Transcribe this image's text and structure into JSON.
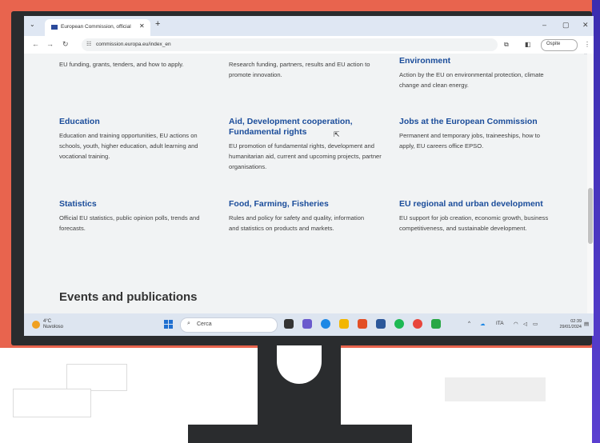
{
  "browser": {
    "tab_title": "European Commission, official",
    "tab_close": "✕",
    "tab_new": "+",
    "url": "commission.europa.eu/index_en",
    "guest_label": "Ospite",
    "window_controls": [
      "–",
      "▢",
      "✕"
    ]
  },
  "content": {
    "partial_top": [
      "EU funding, grants, tenders, and how to apply.",
      "Research funding, partners, results and EU action to promote innovation."
    ],
    "sections": [
      {
        "title": "Environment",
        "desc": "Action by the EU on environmental protection, climate change and clean energy."
      },
      {
        "title": "Education",
        "desc": "Education and training opportunities, EU actions on schools, youth, higher education, adult learning and vocational training."
      },
      {
        "title": "Aid, Development cooperation, Fundamental rights",
        "desc": "EU promotion of fundamental rights, development and humanitarian aid, current and upcoming projects, partner organisations."
      },
      {
        "title": "Jobs at the European Commission",
        "desc": "Permanent and temporary jobs, traineeships, how to apply, EU careers office EPSO."
      },
      {
        "title": "Statistics",
        "desc": "Official EU statistics, public opinion polls, trends and forecasts."
      },
      {
        "title": "Food, Farming, Fisheries",
        "desc": "Rules and policy for safety and quality, information and statistics on products and markets."
      },
      {
        "title": "EU regional and urban development",
        "desc": "EU support for job creation, economic growth, business competitiveness, and sustainable development."
      }
    ],
    "events_heading": "Events and publications"
  },
  "taskbar": {
    "weather_temp": "4°C",
    "weather_desc": "Nuvoloso",
    "search_placeholder": "Cerca",
    "lang": "ITA",
    "time": "02:39",
    "date": "29/01/2024"
  },
  "colors": {
    "wall": "#e8644e",
    "link_blue": "#1a4c9a",
    "monitor": "#2a2c2e"
  }
}
